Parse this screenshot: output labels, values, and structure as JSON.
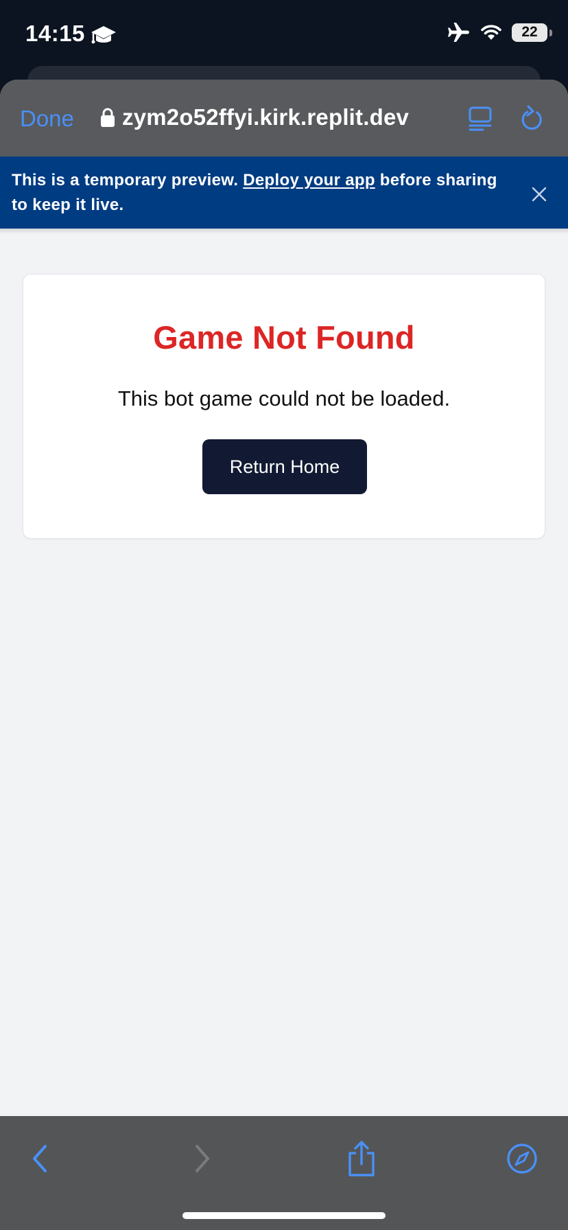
{
  "status_bar": {
    "time": "14:15",
    "time_icon": "graduation-cap-icon",
    "icons": [
      "airplane-icon",
      "wifi-icon"
    ],
    "battery": "22"
  },
  "browser": {
    "done_label": "Done",
    "url": "zym2o52ffyi.kirk.replit.dev",
    "accent_color": "#4a90f6"
  },
  "banner": {
    "text_before": "This is a temporary preview. ",
    "link_text": "Deploy your app",
    "text_after": " before sharing to keep it live.",
    "background": "#003c82"
  },
  "card": {
    "title": "Game Not Found",
    "message": "This bot game could not be loaded.",
    "button_label": "Return Home",
    "title_color": "#dc2626"
  },
  "toolbar": {
    "items": [
      "back-icon",
      "forward-icon",
      "share-icon",
      "compass-icon"
    ]
  }
}
